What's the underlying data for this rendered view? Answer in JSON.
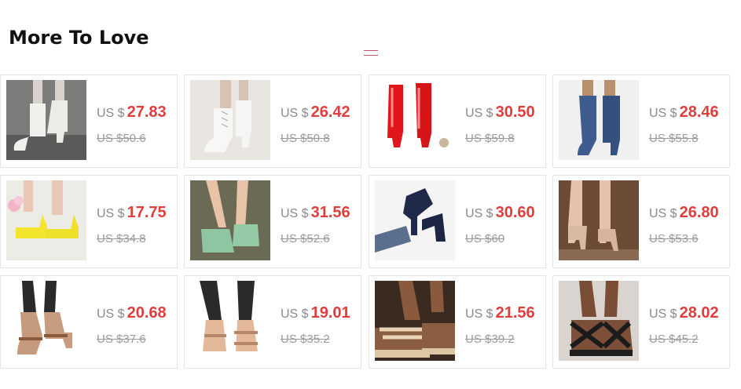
{
  "section": {
    "title": "More To Love"
  },
  "colors": {
    "price": "#e03d3d",
    "muted": "#9a9a9a",
    "border": "#e3e3e3",
    "divider": "#c0506a"
  },
  "products": [
    {
      "currency": "US $",
      "price": "27.83",
      "original": "US $50.6",
      "image": "white-ankle-boot"
    },
    {
      "currency": "US $",
      "price": "26.42",
      "original": "US $50.8",
      "image": "white-lace-up-bootie"
    },
    {
      "currency": "US $",
      "price": "30.50",
      "original": "US $59.8",
      "image": "red-patent-knee-boot"
    },
    {
      "currency": "US $",
      "price": "28.46",
      "original": "US $55.8",
      "image": "blue-denim-knee-boot"
    },
    {
      "currency": "US $",
      "price": "17.75",
      "original": "US $34.8",
      "image": "yellow-mary-jane"
    },
    {
      "currency": "US $",
      "price": "31.56",
      "original": "US $52.6",
      "image": "green-block-mule"
    },
    {
      "currency": "US $",
      "price": "30.60",
      "original": "US $60",
      "image": "navy-platform-pump"
    },
    {
      "currency": "US $",
      "price": "26.80",
      "original": "US $53.6",
      "image": "nude-ankle-strap-pump"
    },
    {
      "currency": "US $",
      "price": "20.68",
      "original": "US $37.6",
      "image": "tan-block-heel-sandal"
    },
    {
      "currency": "US $",
      "price": "19.01",
      "original": "US $35.2",
      "image": "tan-flat-sandal"
    },
    {
      "currency": "US $",
      "price": "21.56",
      "original": "US $39.2",
      "image": "beige-platform-sandal"
    },
    {
      "currency": "US $",
      "price": "28.02",
      "original": "US $45.2",
      "image": "black-strappy-sandal"
    }
  ]
}
